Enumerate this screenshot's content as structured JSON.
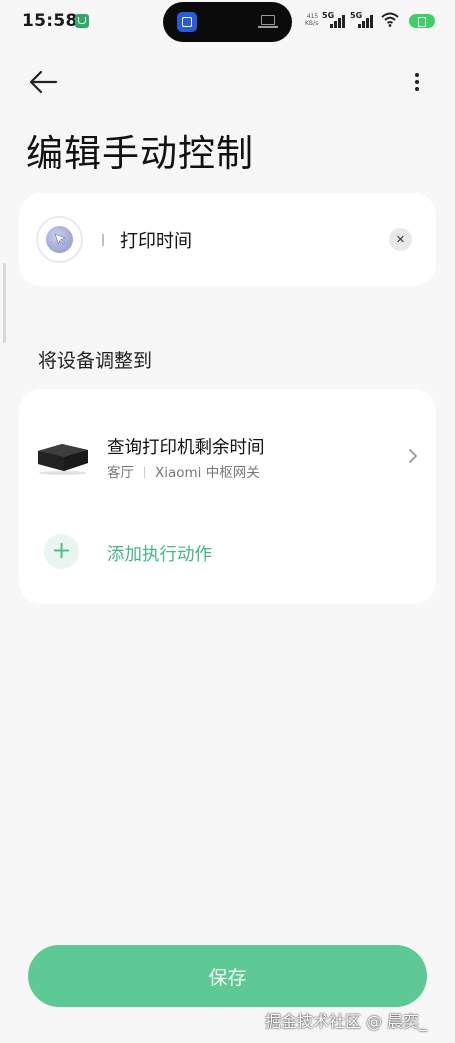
{
  "status_bar": {
    "time": "15:58",
    "speed_value": "415",
    "speed_unit": "KB/s",
    "net1": "5G",
    "net2": "5G"
  },
  "header": {
    "title": "编辑手动控制"
  },
  "name_card": {
    "value": "打印时间",
    "clear_icon": "close-icon"
  },
  "section": {
    "label": "将设备调整到"
  },
  "actions": {
    "items": [
      {
        "title": "查询打印机剩余时间",
        "room": "客厅",
        "device": "Xiaomi 中枢网关"
      }
    ],
    "add_label": "添加执行动作"
  },
  "footer": {
    "save_label": "保存",
    "watermark": "掘金技术社区 @ 晨奕_"
  },
  "colors": {
    "accent": "#5fc996",
    "accent_text": "#45b684",
    "background": "#f7f7f7",
    "card": "#ffffff"
  }
}
